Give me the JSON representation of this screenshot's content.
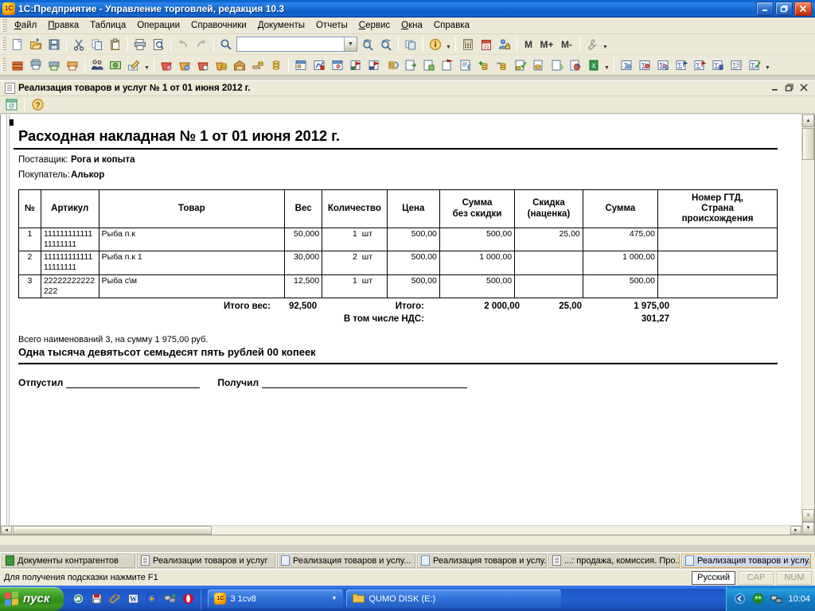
{
  "window": {
    "title": "1С:Предприятие - Управление торговлей, редакция 10.3",
    "app_icon": "1c-icon",
    "minimize": "minimize-icon",
    "maximize": "restore-icon",
    "close": "close-icon"
  },
  "menu": [
    {
      "label": "Файл",
      "accel": "Ф"
    },
    {
      "label": "Правка",
      "accel": "П"
    },
    {
      "label": "Таблица",
      "accel": ""
    },
    {
      "label": "Операции",
      "accel": ""
    },
    {
      "label": "Справочники",
      "accel": ""
    },
    {
      "label": "Документы",
      "accel": ""
    },
    {
      "label": "Отчеты",
      "accel": ""
    },
    {
      "label": "Сервис",
      "accel": "С"
    },
    {
      "label": "Окна",
      "accel": "О"
    },
    {
      "label": "Справка",
      "accel": ""
    }
  ],
  "toolbar_main": {
    "search_value": "",
    "memory_buttons": [
      "M",
      "M+",
      "M-"
    ],
    "icons": [
      "new-document-icon",
      "open-folder-icon",
      "save-icon",
      "cut-icon",
      "copy-icon",
      "paste-icon",
      "print-icon",
      "print-preview-icon",
      "undo-icon",
      "redo-icon",
      "find-icon",
      "search-forward-icon",
      "search-backward-icon",
      "copy-window-icon",
      "info-icon",
      "calculator-icon",
      "calendar-icon",
      "user-lock-icon",
      "wrench-icon"
    ]
  },
  "toolbar_second": {
    "icons": [
      "books-icon",
      "printer-setup-icon",
      "print-doc-icon",
      "labels-icon",
      "users-icon",
      "cash-icon",
      "edit-pen-icon",
      "purchase-icon",
      "sale-icon",
      "return-icon",
      "coins-icon",
      "warehouse-icon",
      "money-hand-icon",
      "coin-stack-icon",
      "report-in-icon",
      "report-red-icon",
      "report-out-icon",
      "flag-green-icon",
      "flag-red-icon",
      "coins-flow-icon",
      "doc-arrow-icon",
      "doc-green-icon",
      "doc-flag-icon",
      "doc-euro-icon",
      "doc-import-icon",
      "coin-plus-icon",
      "coin-minus-icon",
      "doc-check-icon",
      "coin-doc-icon",
      "doc-percent-icon",
      "doc-chart-icon",
      "excel-icon",
      "sum-blue-icon",
      "sum-user-icon",
      "sum-group-icon",
      "sum-flag-icon",
      "sum-red-icon",
      "sum-mark-icon",
      "sum-list-icon",
      "sum-check-icon"
    ]
  },
  "mdi": {
    "title": "Реализация товаров и услуг № 1 от 01 июня 2012 г.",
    "doc_icon": "document-icon",
    "minimize": "minimize-icon",
    "restore": "restore-icon",
    "close": "close-icon",
    "toolbar_icons": [
      "save-print-icon",
      "help-icon"
    ]
  },
  "document": {
    "title": "Расходная накладная № 1 от 01 июня 2012 г.",
    "supplier_label": "Поставщик:",
    "supplier_value": "Рога и копыта",
    "customer_label": "Покупатель:",
    "customer_value": "Алькор",
    "table": {
      "headers": {
        "num": "№",
        "article": "Артикул",
        "goods": "Товар",
        "weight": "Вес",
        "quantity": "Количество",
        "price": "Цена",
        "sum_no_discount": "Сумма\nбез скидки",
        "sum_no_discount_l1": "Сумма",
        "sum_no_discount_l2": "без скидки",
        "discount_l1": "Скидка",
        "discount_l2": "(наценка)",
        "sum": "Сумма",
        "gtd_l1": "Номер ГТД,",
        "gtd_l2": "Страна",
        "gtd_l3": "происхождения"
      },
      "rows": [
        {
          "num": "1",
          "article": "11111111111111111111",
          "goods": "Рыба п.к",
          "weight": "50,000",
          "qty": "1",
          "unit": "шт",
          "price": "500,00",
          "sum_no_discount": "500,00",
          "discount": "25,00",
          "sum": "475,00",
          "gtd": ""
        },
        {
          "num": "2",
          "article": "11111111111111111111",
          "goods": "Рыба п.к 1",
          "weight": "30,000",
          "qty": "2",
          "unit": "шт",
          "price": "500,00",
          "sum_no_discount": "1 000,00",
          "discount": "",
          "sum": "1 000,00",
          "gtd": ""
        },
        {
          "num": "3",
          "article": "22222222222222",
          "goods": "Рыба с\\м",
          "weight": "12,500",
          "qty": "1",
          "unit": "шт",
          "price": "500,00",
          "sum_no_discount": "500,00",
          "discount": "",
          "sum": "500,00",
          "gtd": ""
        }
      ]
    },
    "totals": {
      "weight_label": "Итого вес:",
      "weight_value": "92,500",
      "total_label": "Итого:",
      "vat_label": "В том числе НДС:",
      "total_sum_no_discount": "2 000,00",
      "total_discount": "25,00",
      "total_sum": "1 975,00",
      "vat_value": "301,27"
    },
    "summary_line": "Всего наименований 3, на сумму 1 975,00 руб.",
    "summary_words": "Одна тысяча девятьсот семьдесят пять рублей 00 копеек",
    "sign_released": "Отпустил",
    "sign_received": "Получил"
  },
  "window_tabs": [
    {
      "label": "Документы контрагентов",
      "icon": "green-doc-icon",
      "active": false
    },
    {
      "label": "Реализации товаров и услуг",
      "icon": "lines-doc-icon",
      "active": false
    },
    {
      "label": "Реализация товаров и услу...",
      "icon": "doc-icon",
      "active": false
    },
    {
      "label": "Реализация товаров и услу...",
      "icon": "doc-icon",
      "active": false
    },
    {
      "label": "...: продажа, комиссия. Про...",
      "icon": "lines-doc-icon",
      "active": false
    },
    {
      "label": "Реализация товаров и услу...",
      "icon": "doc-icon",
      "active": true
    }
  ],
  "statusbar": {
    "hint": "Для получения подсказки нажмите F1",
    "language": "Русский",
    "caps": "CAP",
    "num": "NUM"
  },
  "taskbar": {
    "start_label": "пуск",
    "quick_launch": [
      "refresh-icon",
      "save-disk-icon",
      "clip-icon",
      "word-icon",
      "media-player-icon",
      "network-icon",
      "opera-icon"
    ],
    "buttons": [
      {
        "label": "3 1cv8",
        "icon": "1c-icon",
        "has_caret": true
      },
      {
        "label": "QUMO DISK (E:)",
        "icon": "folder-icon",
        "has_caret": false
      }
    ],
    "tray_icons": [
      "show-hidden-icon",
      "antivirus-icon",
      "network-tray-icon"
    ],
    "clock": "10:04"
  },
  "colors": {
    "titlebar_blue": "#0a5fc8",
    "window_face": "#ece9d8",
    "taskbar_blue": "#245fd0",
    "start_green": "#2f8c18",
    "active_tab": "#cfd8e8"
  }
}
